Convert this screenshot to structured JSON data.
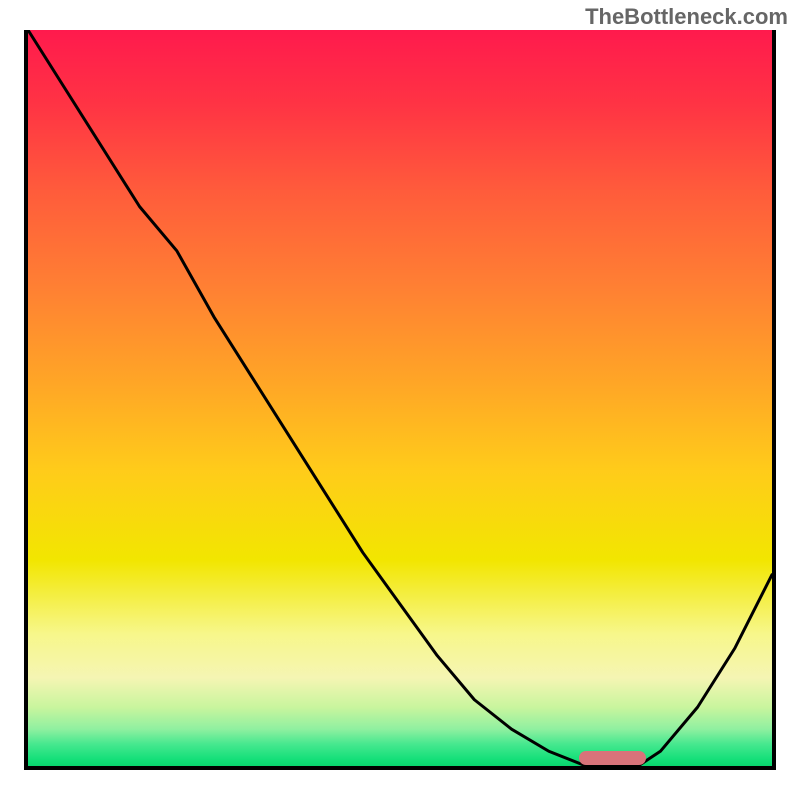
{
  "watermark": "TheBottleneck.com",
  "chart_data": {
    "type": "line",
    "title": "",
    "xlabel": "",
    "ylabel": "",
    "x": [
      0.0,
      0.05,
      0.1,
      0.15,
      0.2,
      0.25,
      0.3,
      0.35,
      0.4,
      0.45,
      0.5,
      0.55,
      0.6,
      0.65,
      0.7,
      0.75,
      0.78,
      0.82,
      0.85,
      0.9,
      0.95,
      1.0
    ],
    "values": [
      1.0,
      0.92,
      0.84,
      0.76,
      0.7,
      0.61,
      0.53,
      0.45,
      0.37,
      0.29,
      0.22,
      0.15,
      0.09,
      0.05,
      0.02,
      0.0,
      0.0,
      0.0,
      0.02,
      0.08,
      0.16,
      0.26
    ],
    "ylim": [
      0,
      1
    ],
    "xlim": [
      0,
      1
    ],
    "marker": {
      "x_start": 0.74,
      "x_end": 0.83,
      "y": 0.01
    },
    "background_gradient": [
      "#ff1a4d",
      "#ffcc1a",
      "#f7f78a",
      "#16e07a"
    ]
  }
}
